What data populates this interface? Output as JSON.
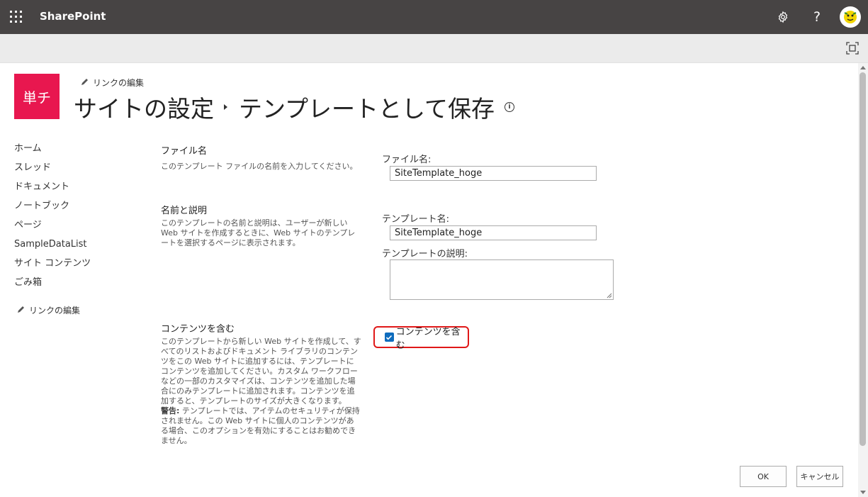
{
  "suitebar": {
    "brand": "SharePoint",
    "icons": [
      "waffle-icon",
      "gear-icon",
      "help-icon",
      "avatar"
    ],
    "help_glyph": "?"
  },
  "site": {
    "logo_text": "単チ",
    "logo_color": "#e8174f",
    "edit_links": "リンクの編集"
  },
  "breadcrumb": {
    "parent": "サイトの設定",
    "current": "テンプレートとして保存",
    "info_glyph": "i"
  },
  "leftnav": {
    "items": [
      "ホーム",
      "スレッド",
      "ドキュメント",
      "ノートブック",
      "ページ",
      "SampleDataList",
      "サイト コンテンツ",
      "ごみ箱"
    ],
    "edit_links": "リンクの編集"
  },
  "form": {
    "file_section": {
      "title": "ファイル名",
      "description": "このテンプレート ファイルの名前を入力してください。",
      "field_label": "ファイル名:",
      "field_value": "SiteTemplate_hoge"
    },
    "name_section": {
      "title": "名前と説明",
      "description": "このテンプレートの名前と説明は、ユーザーが新しい Web サイトを作成するときに、Web サイトのテンプレートを選択するページに表示されます。",
      "name_label": "テンプレート名:",
      "name_value": "SiteTemplate_hoge",
      "desc_label": "テンプレートの説明:",
      "desc_value": ""
    },
    "content_section": {
      "title": "コンテンツを含む",
      "description": "このテンプレートから新しい Web サイトを作成して、すべてのリストおよびドキュメント ライブラリのコンテンツをこの Web サイトに追加するには、テンプレートにコンテンツを追加してください。カスタム ワークフローなどの一部のカスタマイズは、コンテンツを追加した場合にのみテンプレートに追加されます。コンテンツを追加すると、テンプレートのサイズが大きくなります。",
      "warning_label": "警告:",
      "warning_text": " テンプレートでは、アイテムのセキュリティが保持されません。この Web サイトに個人のコンテンツがある場合、このオプションを有効にすることはお勧めできません。",
      "checkbox_label": "コンテンツを含む",
      "checkbox_checked": true,
      "highlight_color": "#e01818"
    }
  },
  "buttons": {
    "ok": "OK",
    "cancel": "キャンセル"
  }
}
